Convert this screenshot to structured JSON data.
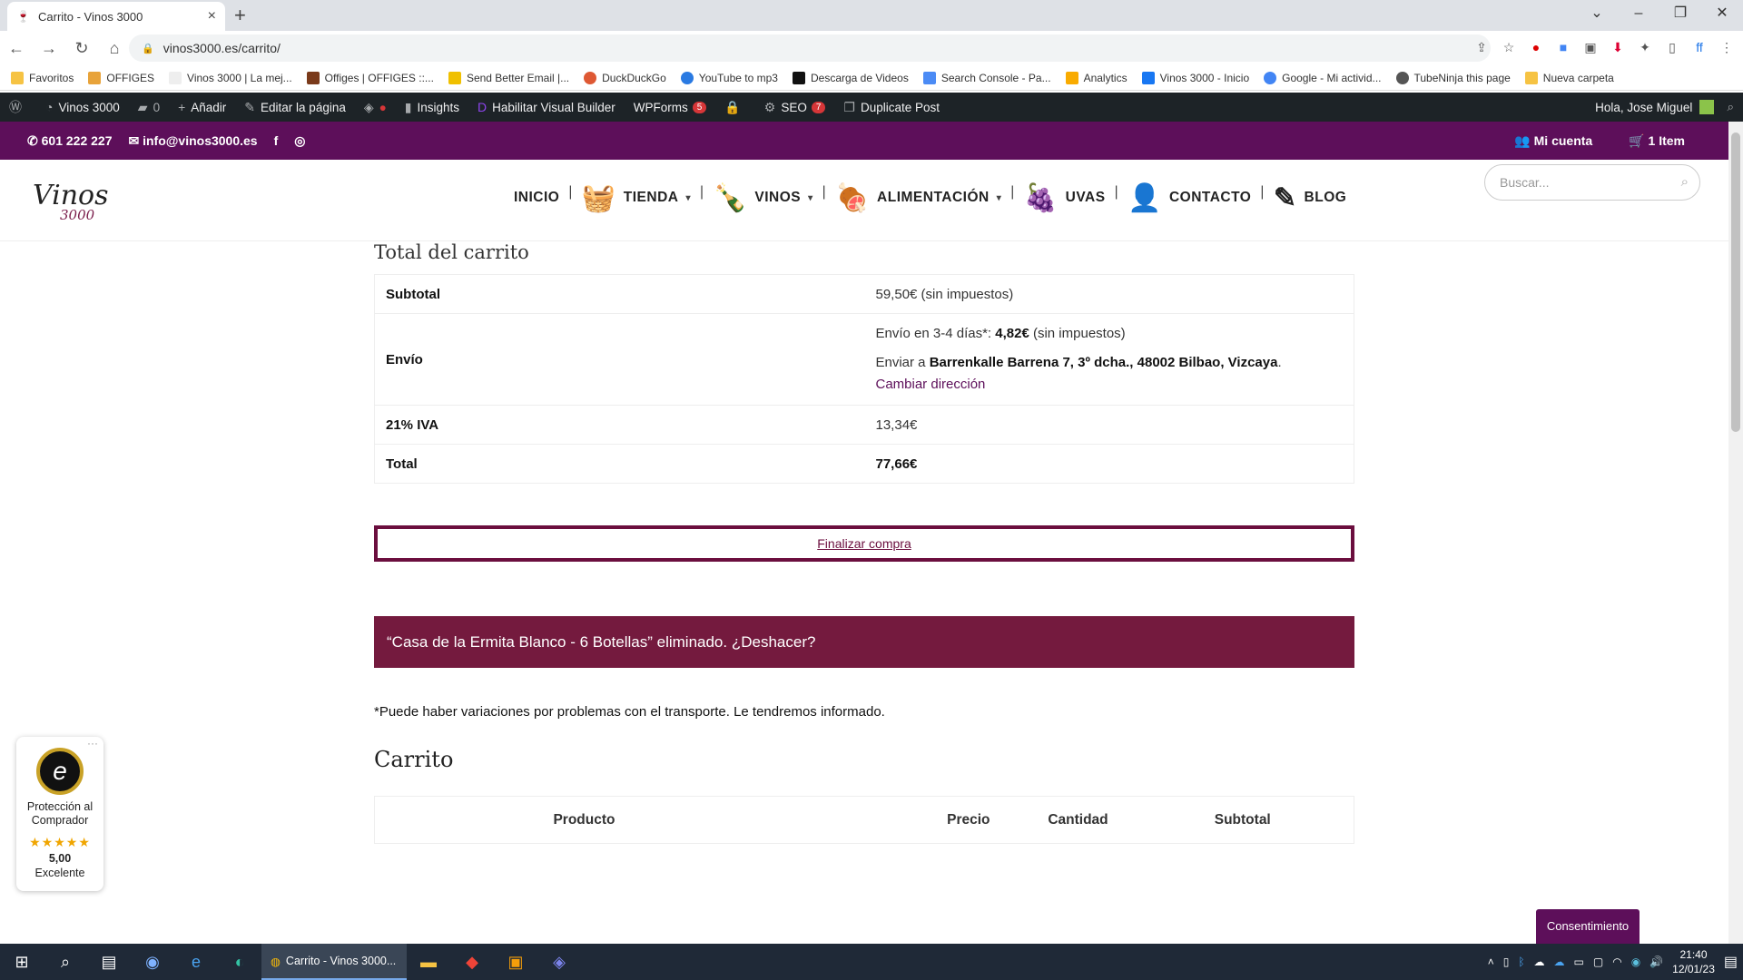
{
  "browser": {
    "tab_title": "Carrito - Vinos 3000",
    "url": "vinos3000.es/carrito/",
    "bookmarks": [
      "Favoritos",
      "OFFIGES",
      "Vinos 3000 | La mej...",
      "Offiges | OFFIGES ::...",
      "Send Better Email |...",
      "DuckDuckGo",
      "YouTube to mp3",
      "Descarga de Videos",
      "Search Console - Pa...",
      "Analytics",
      "Vinos 3000 - Inicio",
      "Google - Mi activid...",
      "TubeNinja this page",
      "Nueva carpeta"
    ]
  },
  "wp_admin": {
    "site": "Vinos 3000",
    "comments": "0",
    "add": "Añadir",
    "edit": "Editar la página",
    "insights": "Insights",
    "visual_builder": "Habilitar Visual Builder",
    "wpforms": "WPForms",
    "wpforms_count": "5",
    "seo": "SEO",
    "seo_count": "7",
    "duplicate": "Duplicate Post",
    "greeting": "Hola, Jose Miguel"
  },
  "topbar": {
    "phone": "601 222 227",
    "email": "info@vinos3000.es",
    "account": "Mi cuenta",
    "cart": "1 Item"
  },
  "header": {
    "logo_text": "Vinos",
    "logo_num": "3000",
    "nav": [
      "INICIO",
      "TIENDA",
      "VINOS",
      "ALIMENTACIÓN",
      "UVAS",
      "CONTACTO",
      "BLOG"
    ],
    "search_placeholder": "Buscar..."
  },
  "totals": {
    "title": "Total del carrito",
    "subtotal_label": "Subtotal",
    "subtotal_value": "59,50€",
    "subtotal_tax": " (sin impuestos)",
    "shipping_label": "Envío",
    "shipping_method": "Envío en 3-4 días*: ",
    "shipping_price": "4,82€",
    "shipping_tax": " (sin impuestos)",
    "ship_to": "Enviar a ",
    "address": "Barrenkalle Barrena 7, 3º dcha., 48002 Bilbao, Vizcaya",
    "change_address": "Cambiar dirección",
    "iva_label": "21% IVA",
    "iva_value": "13,34€",
    "total_label": "Total",
    "total_value": "77,66€"
  },
  "checkout_button": "Finalizar compra",
  "notice": "“Casa de la Ermita Blanco - 6 Botellas” eliminado. ¿Deshacer?",
  "transport_note": "*Puede haber variaciones por problemas con el transporte. Le tendremos informado.",
  "cart": {
    "title": "Carrito",
    "columns": [
      "Producto",
      "Precio",
      "Cantidad",
      "Subtotal"
    ]
  },
  "trust_badge": {
    "label": "Protección al Comprador",
    "rating": "5,00",
    "rating_text": "Excelente"
  },
  "consent": "Consentimiento",
  "taskbar": {
    "chrome_label": "Carrito - Vinos 3000...",
    "time": "21:40",
    "date": "12/01/23"
  }
}
